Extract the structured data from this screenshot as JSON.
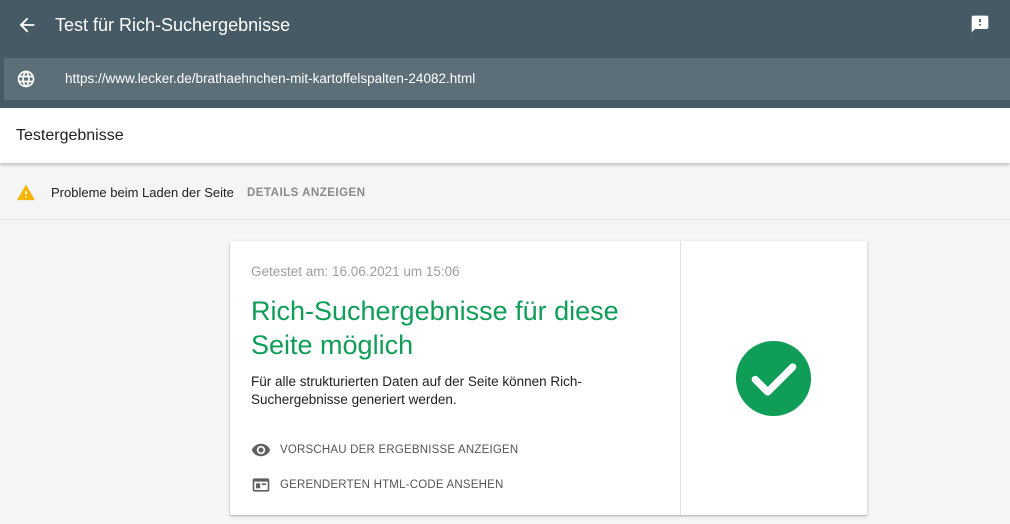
{
  "app": {
    "title": "Test für Rich-Suchergebnisse",
    "url": "https://www.lecker.de/brathaehnchen-mit-kartoffelspalten-24082.html"
  },
  "results_header": {
    "title": "Testergebnisse"
  },
  "warning": {
    "text": "Probleme beim Laden der Seite",
    "link_label": "DETAILS ANZEIGEN"
  },
  "result_card": {
    "tested_at": "Getestet am: 16.06.2021 um 15:06",
    "title": "Rich-Suchergebnisse für diese Seite möglich",
    "description": "Für alle strukturierten Daten auf der Seite können Rich-Suchergebnisse generiert werden.",
    "actions": [
      {
        "label": "VORSCHAU DER ERGEBNISSE ANZEIGEN",
        "icon": "eye-icon"
      },
      {
        "label": "GERENDERTEN HTML-CODE ANSEHEN",
        "icon": "browser-window-icon"
      }
    ],
    "status_icon": "check-circle-icon"
  },
  "colors": {
    "header_bg": "#455a64",
    "url_bar_bg": "#5c6f78",
    "success_green": "#0f9d58",
    "warning_amber": "#f4b400"
  },
  "icons": {
    "back": "arrow-back-icon",
    "feedback": "feedback-icon",
    "globe": "globe-icon",
    "warning": "warning-icon"
  }
}
